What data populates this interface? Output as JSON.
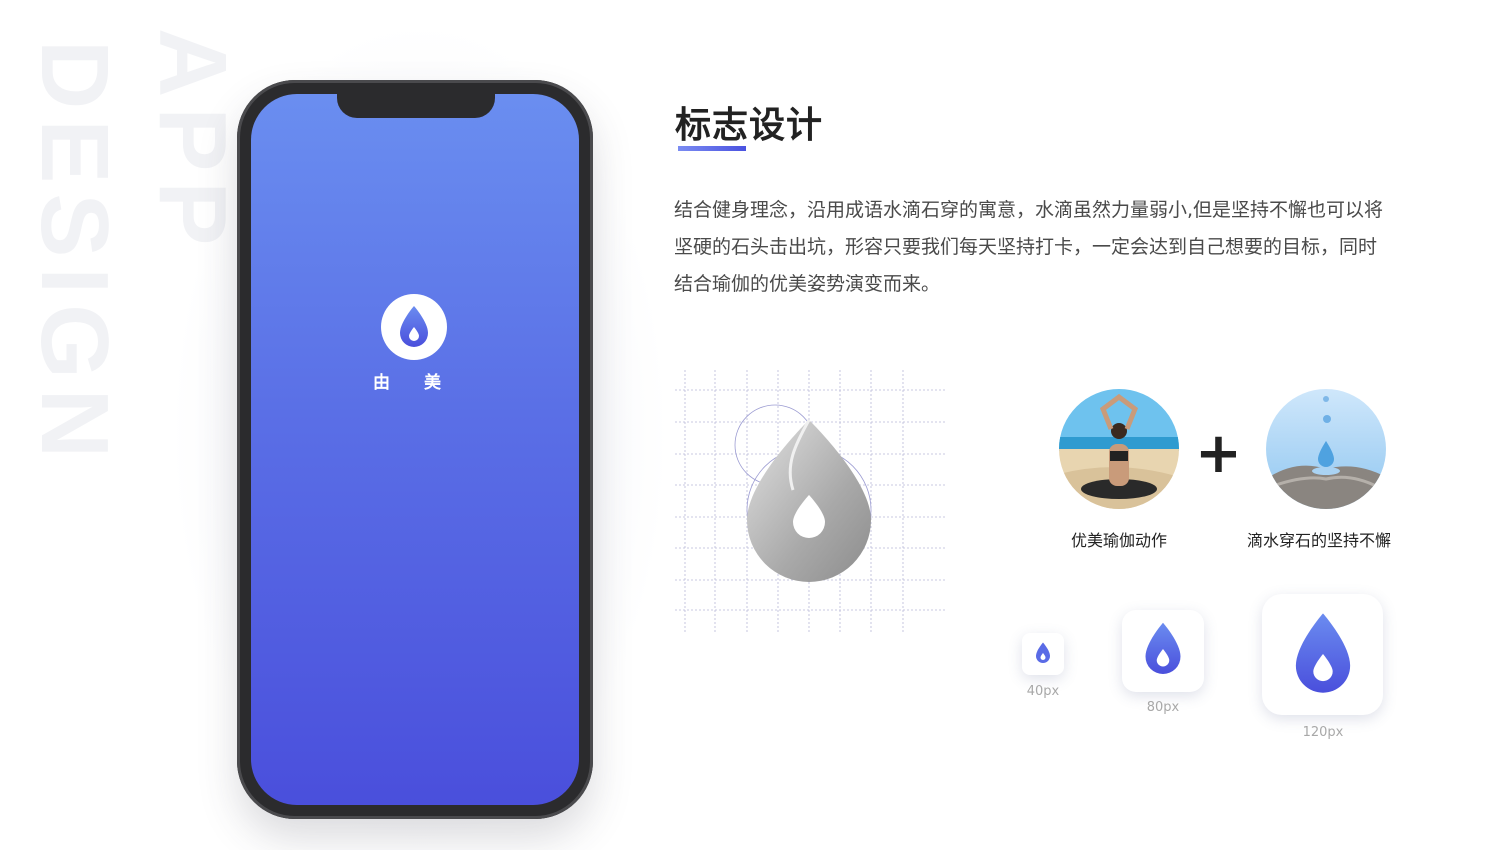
{
  "background_text": {
    "line1": "APP",
    "line2": "DESIGN"
  },
  "phone": {
    "app_name": "由 美"
  },
  "section": {
    "title": "标志设计",
    "description": "结合健身理念，沿用成语水滴石穿的寓意，水滴虽然力量弱小,但是坚持不懈也可以将坚硬的石头击出坑，形容只要我们每天坚持打卡，一定会达到自己想要的目标，同时结合瑜伽的优美姿势演变而来。"
  },
  "inspiration": {
    "left_caption": "优美瑜伽动作",
    "plus": "+",
    "right_caption": "滴水穿石的坚持不懈"
  },
  "icon_sizes": [
    {
      "label": "40px"
    },
    {
      "label": "80px"
    },
    {
      "label": "120px"
    }
  ],
  "colors": {
    "brand_start": "#6a8ef0",
    "brand_end": "#4a4fdc",
    "accent": "#4a52e0"
  }
}
